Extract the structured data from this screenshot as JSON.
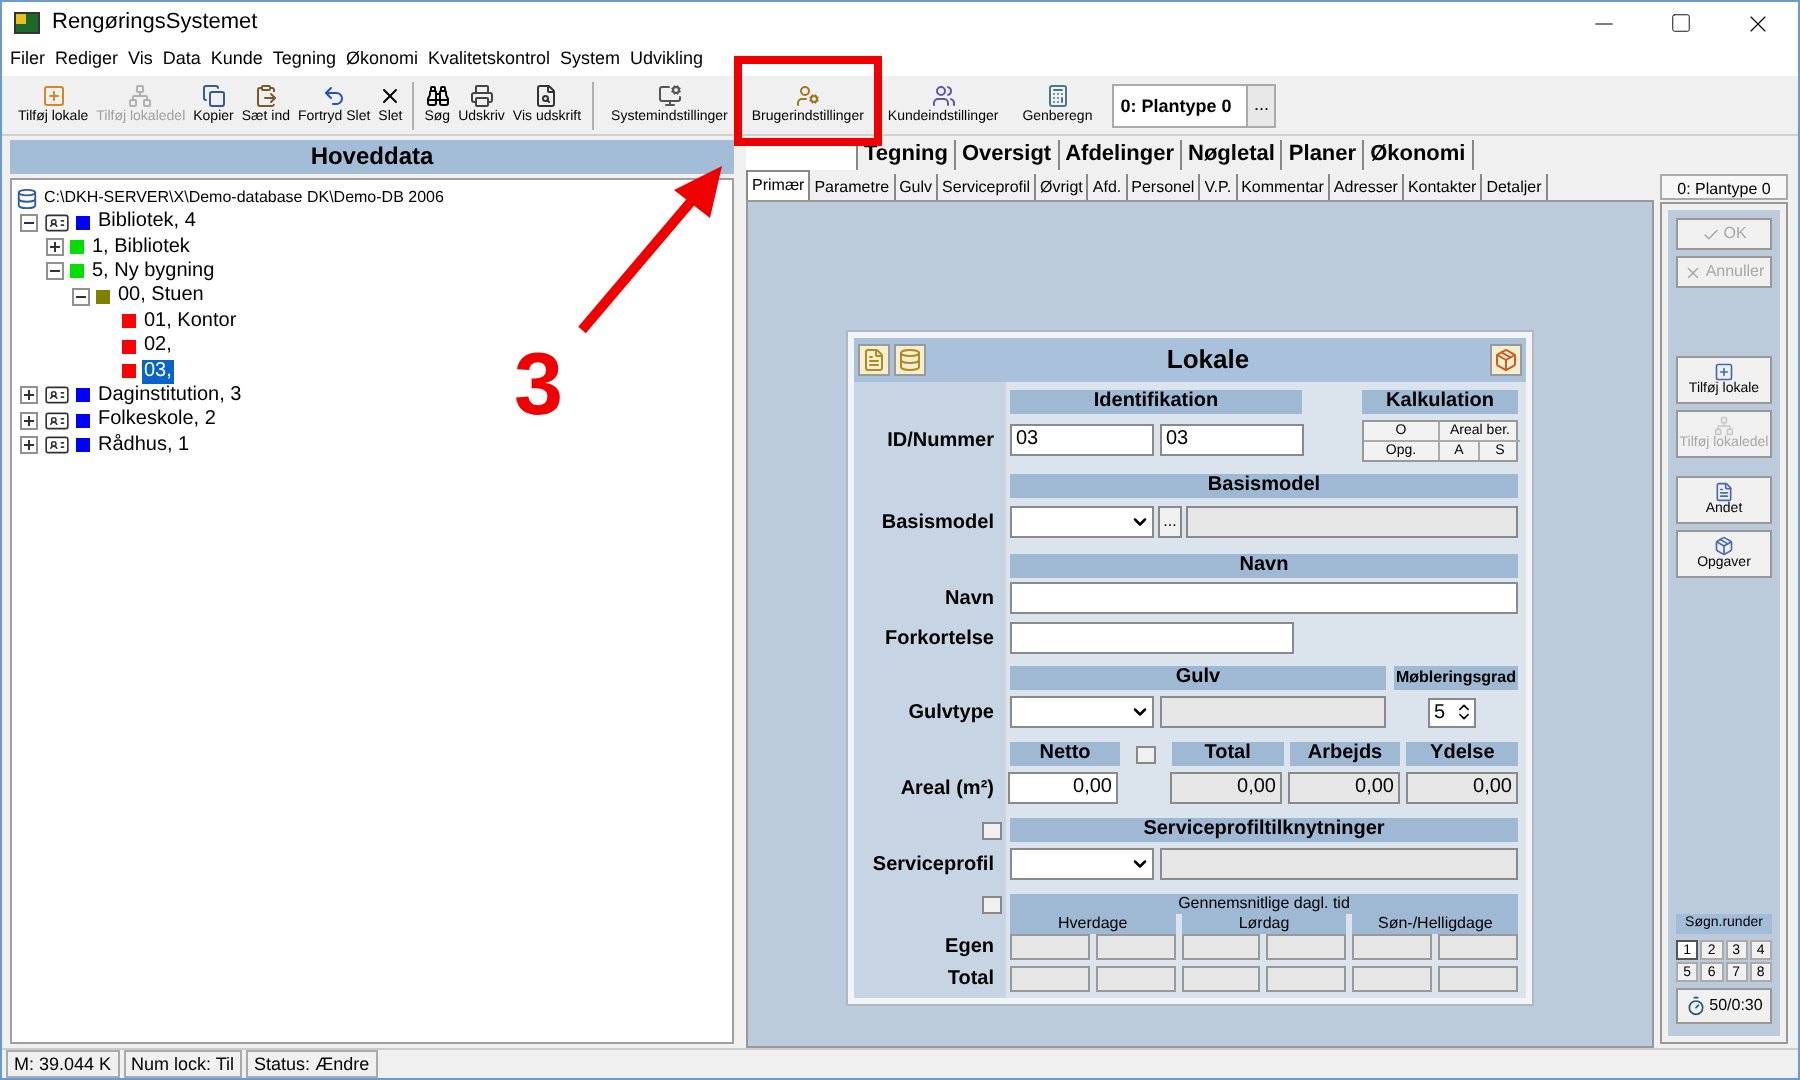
{
  "window": {
    "title": "RengøringsSystemet"
  },
  "menu": [
    "Filer",
    "Rediger",
    "Vis",
    "Data",
    "Kunde",
    "Tegning",
    "Økonomi",
    "Kvalitetskontrol",
    "System",
    "Udvikling"
  ],
  "toolbar": {
    "groups": [
      [
        {
          "label": "Tilføj lokale",
          "disabled": false
        },
        {
          "label": "Tilføj lokaledel",
          "disabled": true
        },
        {
          "label": "Kopier",
          "disabled": false
        },
        {
          "label": "Sæt ind",
          "disabled": false
        },
        {
          "label": "Fortryd Slet",
          "disabled": false
        },
        {
          "label": "Slet",
          "disabled": false
        }
      ],
      [
        {
          "label": "Søg",
          "disabled": false
        },
        {
          "label": "Udskriv",
          "disabled": false
        },
        {
          "label": "Vis udskrift",
          "disabled": false
        }
      ],
      [
        {
          "label": "Systemindstillinger",
          "disabled": false
        },
        {
          "label": "Brugerindstillinger",
          "disabled": false
        },
        {
          "label": "Kundeindstillinger",
          "disabled": false
        },
        {
          "label": "Genberegn",
          "disabled": false
        }
      ]
    ],
    "plantype": "0: Plantype 0",
    "plantype_button": "..."
  },
  "left_panel": {
    "title": "Hoveddata",
    "root": "C:\\DKH-SERVER\\X\\Demo-database DK\\Demo-DB 2006",
    "tree": [
      {
        "label": "Bibliotek, 4",
        "color": "#0000ff",
        "expanded": true,
        "selected": false,
        "children": [
          {
            "label": "1, Bibliotek",
            "color": "#00e000",
            "expanded": false,
            "selected": false
          },
          {
            "label": "5, Ny bygning",
            "color": "#00e000",
            "expanded": true,
            "selected": false,
            "children": [
              {
                "label": "00, Stuen",
                "color": "#808000",
                "expanded": true,
                "selected": false,
                "children": [
                  {
                    "label": "01, Kontor",
                    "color": "#ff0000",
                    "selected": false
                  },
                  {
                    "label": "02,",
                    "color": "#ff0000",
                    "selected": false
                  },
                  {
                    "label": "03,",
                    "color": "#ff0000",
                    "selected": true
                  }
                ]
              }
            ]
          }
        ]
      },
      {
        "label": "Daginstitution, 3",
        "color": "#0000ff",
        "expanded": false,
        "selected": false
      },
      {
        "label": "Folkeskole, 2",
        "color": "#0000ff",
        "expanded": false,
        "selected": false
      },
      {
        "label": "Rådhus, 1",
        "color": "#0000ff",
        "expanded": false,
        "selected": false
      }
    ]
  },
  "main_tabs": [
    {
      "selected": true
    },
    {
      "label": "Tegning",
      "selected": false
    },
    {
      "label": "Oversigt",
      "selected": false
    },
    {
      "label": "Afdelinger",
      "selected": false
    },
    {
      "label": "Nøgletal",
      "selected": false
    },
    {
      "label": "Planer",
      "selected": false
    },
    {
      "label": "Økonomi",
      "selected": false
    }
  ],
  "sub_tabs": [
    {
      "label": "Primær",
      "selected": true
    },
    {
      "label": "Parametre",
      "selected": false
    },
    {
      "label": "Gulv",
      "selected": false
    },
    {
      "label": "Serviceprofil",
      "selected": false
    },
    {
      "label": "Øvrigt",
      "selected": false
    },
    {
      "label": "Afd.",
      "selected": false
    },
    {
      "label": "Personel",
      "selected": false
    },
    {
      "label": "V.P.",
      "selected": false
    },
    {
      "label": "Kommentar",
      "selected": false
    },
    {
      "label": "Adresser",
      "selected": false
    },
    {
      "label": "Kontakter",
      "selected": false
    },
    {
      "label": "Detaljer",
      "selected": false
    }
  ],
  "form": {
    "title": "Lokale",
    "identification": {
      "header": "Identifikation",
      "label": "ID/Nummer",
      "values": [
        "03",
        "03"
      ]
    },
    "calculation": {
      "header": "Kalkulation",
      "cells": [
        "O",
        "Areal ber.",
        "Opg.",
        "A",
        "S"
      ]
    },
    "basismodel": {
      "header": "Basismodel",
      "label": "Basismodel",
      "button": "..."
    },
    "name": {
      "header": "Navn",
      "label": "Navn",
      "abbrev_label": "Forkortelse"
    },
    "floor": {
      "header": "Gulv",
      "label": "Gulvtype",
      "furnishing_header": "Møbleringsgrad",
      "furnishing_value": "5"
    },
    "area": {
      "label": "Areal (m²)",
      "columns": [
        {
          "header": "Netto",
          "value": "0,00",
          "editable": true
        },
        {
          "header": "Total",
          "value": "0,00",
          "editable": false
        },
        {
          "header": "Arbejds",
          "value": "0,00",
          "editable": false
        },
        {
          "header": "Ydelse",
          "value": "0,00",
          "editable": false
        }
      ]
    },
    "service": {
      "header": "Serviceprofiltilknytninger",
      "label": "Serviceprofil"
    },
    "daily": {
      "header": "Gennemsnitlige dagl. tid",
      "groups": [
        "Hverdage",
        "Lørdag",
        "Søn-/Helligdage"
      ],
      "rows": [
        "Egen",
        "Total"
      ]
    }
  },
  "side_panel": {
    "header": "0: Plantype 0",
    "groups": [
      [
        {
          "label": "OK",
          "disabled": true,
          "kind": "inline"
        },
        {
          "label": "Annuller",
          "disabled": true,
          "kind": "inline"
        }
      ],
      [
        {
          "label": "Tilføj lokale",
          "disabled": false,
          "kind": "stacked"
        },
        {
          "label": "Tilføj lokaledel",
          "disabled": true,
          "kind": "stacked"
        }
      ],
      [
        {
          "label": "Andet",
          "disabled": false,
          "kind": "stacked"
        },
        {
          "label": "Opgaver",
          "disabled": false,
          "kind": "stacked"
        }
      ]
    ],
    "rounds_title": "Søgn.runder",
    "rounds": [
      {
        "label": "1",
        "selected": true
      },
      {
        "label": "2",
        "selected": false
      },
      {
        "label": "3",
        "selected": false
      },
      {
        "label": "4",
        "selected": false
      },
      {
        "label": "5",
        "selected": false
      },
      {
        "label": "6",
        "selected": false
      },
      {
        "label": "7",
        "selected": false
      },
      {
        "label": "8",
        "selected": false
      }
    ],
    "timer": "50/0:30"
  },
  "status_bar": [
    "M: 39.044 K",
    "Num lock: Til",
    "Status: Ændre"
  ],
  "annotation": {
    "label": "3"
  }
}
